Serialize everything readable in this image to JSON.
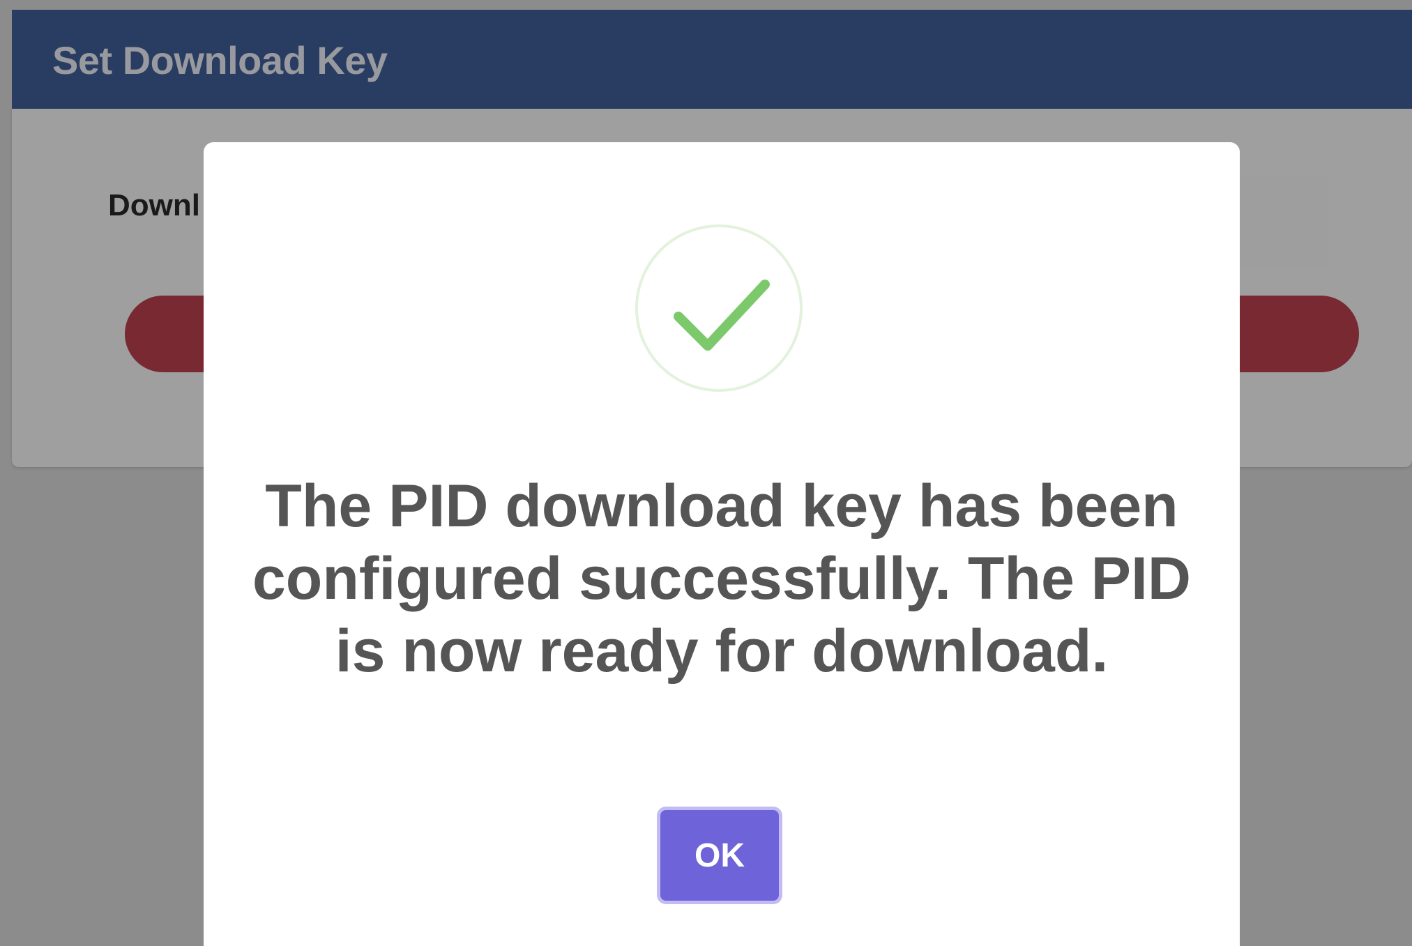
{
  "page": {
    "title": "Set Download Key",
    "field_label": "Downl",
    "header_color": "#2a4b8a",
    "button_color": "#b22a38"
  },
  "modal": {
    "icon": "checkmark-icon",
    "icon_color": "#7cc96b",
    "message": "The PID download key has been configured successfully. The PID is now ready for download.",
    "ok_label": "OK",
    "ok_color": "#6f63da"
  }
}
